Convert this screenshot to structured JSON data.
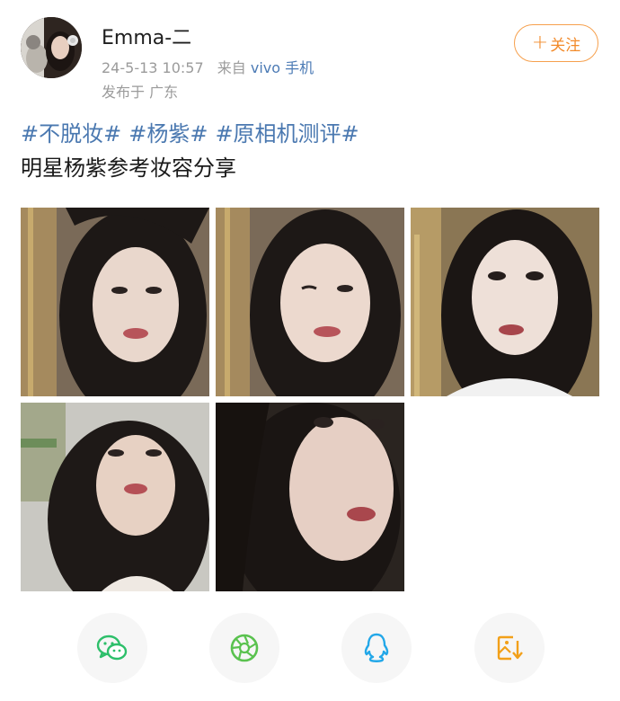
{
  "user": {
    "name": "Emma-二",
    "time": "24-5-13 10:57",
    "source_prefix": "来自",
    "source_device": "vivo 手机",
    "location": "发布于 广东"
  },
  "follow_button": {
    "plus": "+",
    "label": "关注"
  },
  "post": {
    "hashtags": [
      "#不脱妆#",
      "#杨紫#",
      "#原相机测评#"
    ],
    "text": "明星杨紫参考妆容分享",
    "photo_count": 5
  },
  "actions": [
    {
      "name": "wechat",
      "icon": "wechat-icon",
      "color": "#2dbf6a"
    },
    {
      "name": "moments",
      "icon": "moments-icon",
      "color": "#5ac24f"
    },
    {
      "name": "qq",
      "icon": "qq-icon",
      "color": "#22a7e8"
    },
    {
      "name": "save-image",
      "icon": "save-image-icon",
      "color": "#f2a019"
    }
  ]
}
